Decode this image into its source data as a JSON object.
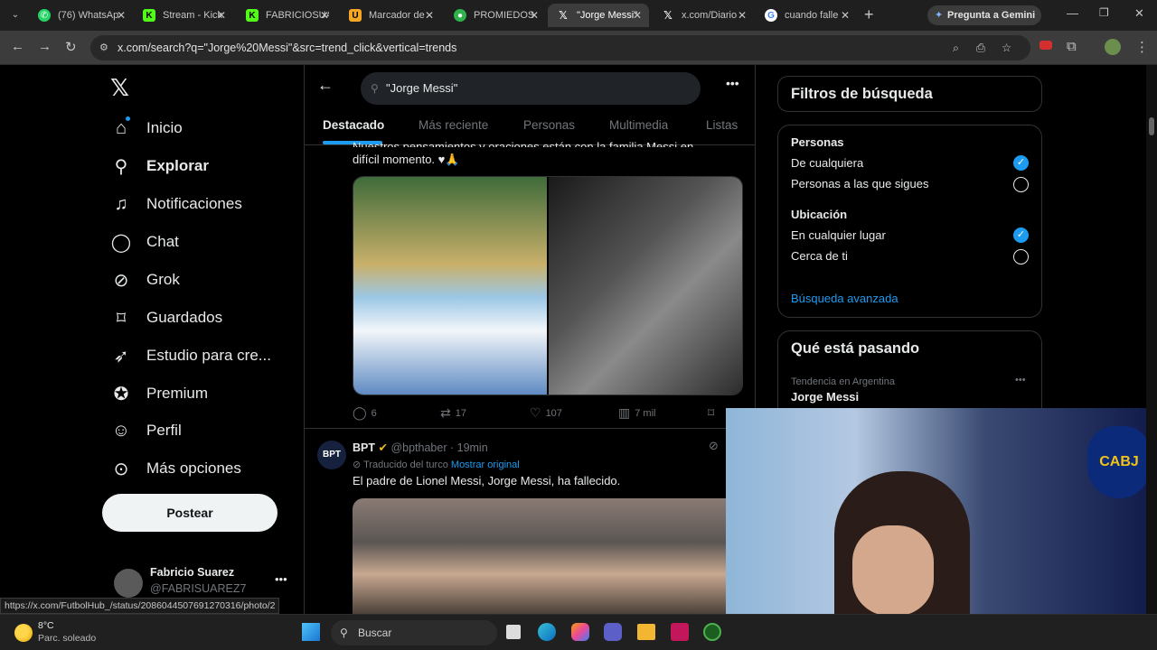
{
  "browser": {
    "tabs": [
      {
        "label": "(76) WhatsAp",
        "icon": "whatsapp-icon",
        "color": "#25d366"
      },
      {
        "label": "Stream - Kick",
        "icon": "kick-icon",
        "color": "#53fc18"
      },
      {
        "label": "FABRICIOSUA",
        "icon": "kick-icon",
        "color": "#53fc18"
      },
      {
        "label": "Marcador de",
        "icon": "u-icon",
        "color": "#f5a623"
      },
      {
        "label": "PROMIEDOS",
        "icon": "promiedos-icon",
        "color": "#2fb24c"
      },
      {
        "label": "\"Jorge Messi\"",
        "icon": "x-icon",
        "color": "#ffffff"
      },
      {
        "label": "x.com/Diario",
        "icon": "x-icon",
        "color": "#ffffff"
      },
      {
        "label": "cuando falle",
        "icon": "google-icon",
        "color": "#4285f4"
      }
    ],
    "gemini_label": "Pregunta a Gemini",
    "url": "x.com/search?q=\"Jorge%20Messi\"&src=trend_click&vertical=trends"
  },
  "sidebar": {
    "items": [
      {
        "label": "Inicio",
        "icon": "home-icon"
      },
      {
        "label": "Explorar",
        "icon": "search-icon"
      },
      {
        "label": "Notificaciones",
        "icon": "bell-icon"
      },
      {
        "label": "Chat",
        "icon": "chat-icon"
      },
      {
        "label": "Grok",
        "icon": "grok-icon"
      },
      {
        "label": "Guardados",
        "icon": "bookmark-icon"
      },
      {
        "label": "Estudio para cre...",
        "icon": "rocket-icon"
      },
      {
        "label": "Premium",
        "icon": "verified-icon"
      },
      {
        "label": "Perfil",
        "icon": "person-icon"
      },
      {
        "label": "Más opciones",
        "icon": "more-circle-icon"
      }
    ],
    "post_label": "Postear",
    "user": {
      "name": "Fabricio Suarez",
      "handle": "@FABRISUAREZ7"
    }
  },
  "search": {
    "query": "\"Jorge Messi\""
  },
  "tabs": [
    "Destacado",
    "Más reciente",
    "Personas",
    "Multimedia",
    "Listas"
  ],
  "tweet1": {
    "text_partial": "Nuestros pensamientos y oraciones están con la familia Messi en este",
    "text_line2": "difícil momento. ♥🙏",
    "replies": "6",
    "retweets": "17",
    "likes": "107",
    "views": "7 mil"
  },
  "tweet2": {
    "author": "BPT",
    "handle": "@bpthaber",
    "time": "· 19min",
    "translated": "Traducido del turco",
    "show_original": "Mostrar original",
    "text": "El padre de Lionel Messi, Jorge Messi, ha fallecido."
  },
  "filters": {
    "title": "Filtros de búsqueda",
    "people_heading": "Personas",
    "people_opt1": "De cualquiera",
    "people_opt2": "Personas a las que sigues",
    "location_heading": "Ubicación",
    "loc_opt1": "En cualquier lugar",
    "loc_opt2": "Cerca de ti",
    "advanced": "Búsqueda avanzada"
  },
  "trending": {
    "title": "Qué está pasando",
    "context": "Tendencia en Argentina",
    "topic": "Jorge Messi"
  },
  "status_url": "https://x.com/FutbolHub_/status/2086044507691270316/photo/2",
  "weather": {
    "temp": "8°C",
    "cond": "Parc. soleado"
  },
  "taskbar": {
    "search_placeholder": "Buscar"
  },
  "colors": {
    "accent": "#1d9bf0",
    "background": "#000000",
    "border": "#2f3336"
  }
}
